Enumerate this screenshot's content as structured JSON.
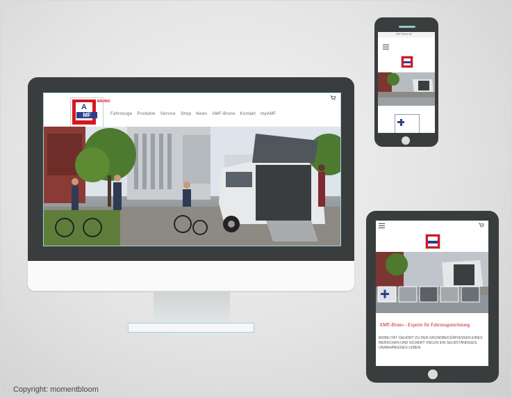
{
  "desktop": {
    "nav": [
      "Fahrzeuge",
      "Produkte",
      "Service",
      "Shop",
      "News",
      "AMF-Bruno",
      "Kontakt",
      "myAMF"
    ],
    "logo": {
      "letter": "A",
      "mark": "MF",
      "wordmark": "BRUNO"
    },
    "icons": {
      "cart": "cart-icon"
    }
  },
  "phone": {
    "status_bar": "AMF-Bruno.de",
    "icons": {
      "menu": "hamburger-icon"
    }
  },
  "tablet": {
    "heading": "AMF-Bruno - Experte für Fahrzeugumrüstung",
    "body": "MOBILITÄT GEHÖRT ZU DEN GRUNDBEDÜRFNISSEN EINES MENSCHEN UND SICHERT VIELEN EIN SELBSTÄNDIGES, UNABHÄNGIGES LEBEN.",
    "icons": {
      "menu": "hamburger-icon",
      "cart": "cart-icon"
    }
  },
  "copyright": "Copyright: momentbloom",
  "colors": {
    "device": "#3a3d3d",
    "brand_red": "#d51820",
    "brand_blue": "#2a3f8f",
    "accent": "#9ed3d6"
  }
}
